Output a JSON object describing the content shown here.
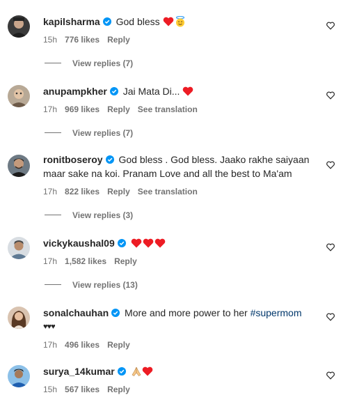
{
  "colors": {
    "text": "#262626",
    "secondary": "#737373",
    "verified": "#0095f6",
    "heart": "#ed1c24",
    "hashtag": "#00376b"
  },
  "comments": [
    {
      "username": "kapilsharma",
      "verified": true,
      "text": "God bless",
      "emojis": [
        "red-heart",
        "smiling-face-with-halo"
      ],
      "time": "15h",
      "likes": "776 likes",
      "reply": "Reply",
      "view_replies": "View replies (7)"
    },
    {
      "username": "anupampkher",
      "verified": true,
      "text": "Jai Mata Di...",
      "emojis": [
        "red-heart"
      ],
      "time": "17h",
      "likes": "969 likes",
      "reply": "Reply",
      "translation": "See translation",
      "view_replies": "View replies (7)"
    },
    {
      "username": "ronitboseroy",
      "verified": true,
      "text_line1": "God bless . God bless. Jaako rakhe saiyaan",
      "text_line2": "maar sake na koi. Pranam Love and all the best to Ma'am",
      "time": "17h",
      "likes": "822 likes",
      "reply": "Reply",
      "translation": "See translation",
      "view_replies": "View replies (3)"
    },
    {
      "username": "vickykaushal09",
      "verified": true,
      "emojis": [
        "red-heart",
        "red-heart",
        "red-heart"
      ],
      "time": "17h",
      "likes": "1,582 likes",
      "reply": "Reply",
      "view_replies": "View replies (13)"
    },
    {
      "username": "sonalchauhan",
      "verified": true,
      "text": "More and more power to her",
      "hashtag": "#supermom",
      "line2": "♥♥♥",
      "time": "17h",
      "likes": "496 likes",
      "reply": "Reply"
    },
    {
      "username": "surya_14kumar",
      "verified": true,
      "emojis": [
        "folded-hands",
        "red-heart"
      ],
      "time": "15h",
      "likes": "567 likes",
      "reply": "Reply"
    }
  ]
}
